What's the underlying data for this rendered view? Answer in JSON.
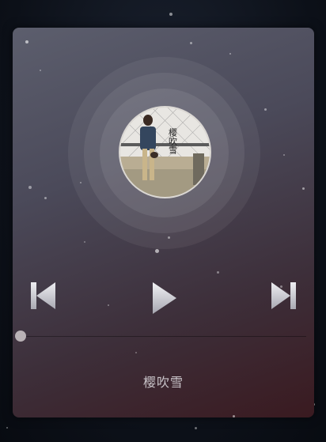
{
  "player": {
    "song_title": "樱吹雪",
    "progress": 0,
    "cover_caption": "樱吹雪"
  },
  "icons": {
    "previous": "skip-previous-icon",
    "play": "play-icon",
    "next": "skip-next-icon"
  },
  "colors": {
    "card_top": "#5c5e6d",
    "card_bottom": "#3a1a20",
    "control": "#d8d8dc",
    "title": "#c8c3c8"
  }
}
